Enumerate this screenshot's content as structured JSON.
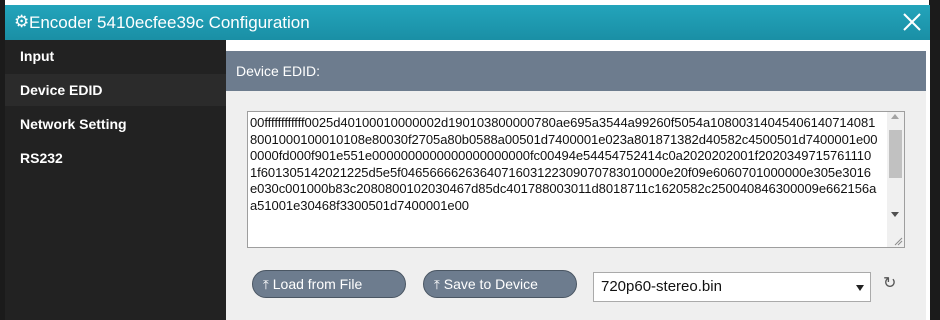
{
  "window": {
    "title": "Encoder 5410ecfee39c Configuration",
    "icons": {
      "title": "gear-icon",
      "close": "close-icon"
    }
  },
  "sidebar": {
    "items": [
      {
        "label": "Input"
      },
      {
        "label": "Device EDID"
      },
      {
        "label": "Network Setting"
      },
      {
        "label": "RS232"
      }
    ]
  },
  "section": {
    "title": "Device EDID:"
  },
  "edid": {
    "value": "00ffffffffffff0025d40100010000002d190103800000780ae695a3544a99260f5054a108003140454061407140818001000100010108e80030f2705a80b0588a00501d7400001e023a801871382d40582c4500501d7400001e000000fd000f901e551e0000000000000000000000fc00494e54454752414c0a2020202001f20203497157611101f601305142021225d5e5f0465666626364071603122309070783010000e20f09e6060701000000e305e3016e030c001000b83c2080800102030467d85dc401788003011d8018711c1620582c250040846300009e662156aa51001e30468f3300501d7400001e00"
  },
  "actions": {
    "load_label": "Load from File",
    "save_label": "Save to Device",
    "upload_icon": "upload-icon"
  },
  "file_select": {
    "selected": "720p60-stereo.bin"
  },
  "colors": {
    "titlebar": "#1f98af",
    "sidebar": "#222222",
    "header": "#6d7c8e",
    "body": "#efefef"
  }
}
